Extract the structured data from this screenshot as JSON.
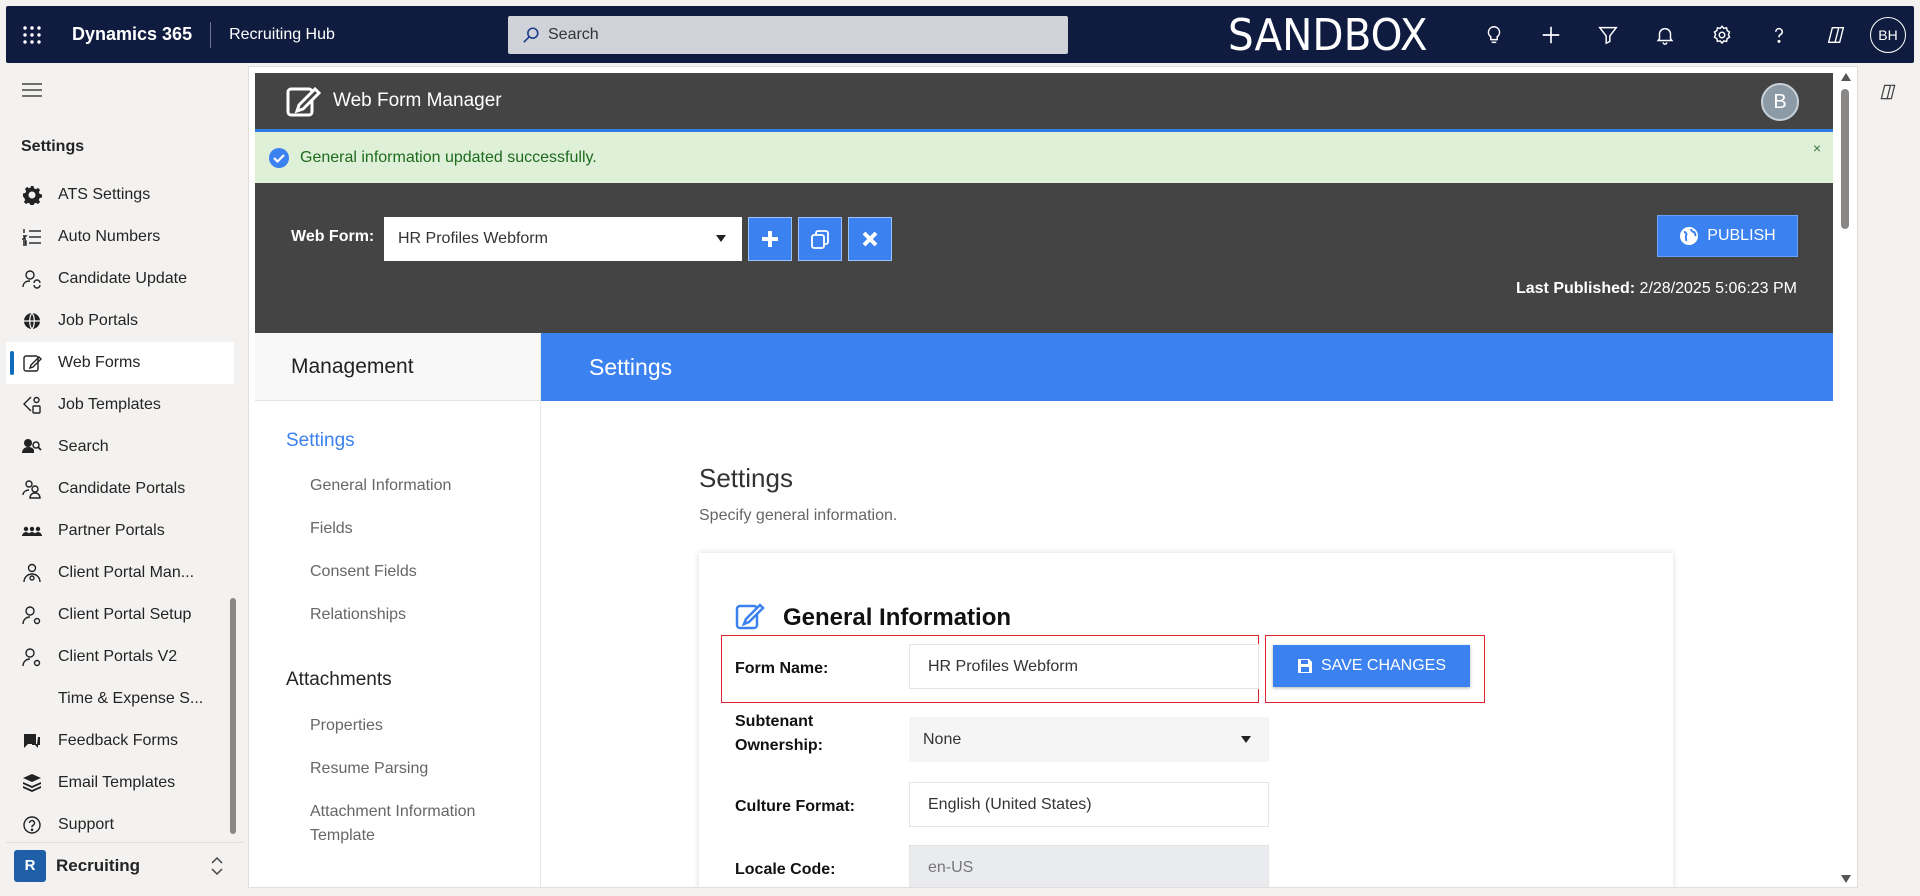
{
  "topbar": {
    "app_name": "Dynamics 365",
    "area_name": "Recruiting Hub",
    "search_placeholder": "Search",
    "environment": "SANDBOX",
    "user_initials": "BH"
  },
  "sidebar": {
    "heading": "Settings",
    "items": [
      {
        "label": "ATS Settings",
        "icon": "gear-icon"
      },
      {
        "label": "Auto Numbers",
        "icon": "numbered-list-icon"
      },
      {
        "label": "Candidate Update",
        "icon": "person-sync-icon"
      },
      {
        "label": "Job Portals",
        "icon": "globe-icon"
      },
      {
        "label": "Web Forms",
        "icon": "form-edit-icon",
        "active": true
      },
      {
        "label": "Job Templates",
        "icon": "template-icon"
      },
      {
        "label": "Search",
        "icon": "search-people-icon"
      },
      {
        "label": "Candidate Portals",
        "icon": "people-icon"
      },
      {
        "label": "Partner Portals",
        "icon": "group-icon"
      },
      {
        "label": "Client Portal Man...",
        "icon": "person-settings-icon"
      },
      {
        "label": "Client Portal Setup",
        "icon": "person-icon"
      },
      {
        "label": "Client Portals V2",
        "icon": "person-icon"
      },
      {
        "label": "Time & Expense S...",
        "icon": ""
      },
      {
        "label": "Feedback Forms",
        "icon": "feedback-icon"
      },
      {
        "label": "Email Templates",
        "icon": "layers-icon"
      },
      {
        "label": "Support",
        "icon": "question-icon"
      }
    ],
    "footer": {
      "badge": "R",
      "label": "Recruiting"
    }
  },
  "wfm": {
    "title": "Web Form Manager",
    "avatar": "B",
    "success_message": "General information updated successfully.",
    "close": "×",
    "webform_label": "Web Form:",
    "webform_value": "HR Profiles Webform",
    "publish_label": "PUBLISH",
    "last_published_label": "Last Published:",
    "last_published_value": "2/28/2025 5:06:23 PM"
  },
  "management": {
    "title": "Management",
    "sections": [
      {
        "label": "Settings",
        "items": [
          "General Information",
          "Fields",
          "Consent Fields",
          "Relationships"
        ]
      },
      {
        "label": "Attachments",
        "items": [
          "Properties",
          "Resume Parsing",
          "Attachment Information Template"
        ]
      }
    ]
  },
  "settings": {
    "banner": "Settings",
    "title": "Settings",
    "subtitle": "Specify general information.",
    "card_title": "General Information",
    "form_name_label": "Form Name:",
    "form_name_value": "HR Profiles Webform",
    "save_label": "SAVE CHANGES",
    "subtenant_label": "Subtenant Ownership:",
    "subtenant_value": "None",
    "culture_label": "Culture Format:",
    "culture_value": "English (United States)",
    "locale_label": "Locale Code:",
    "locale_value": "en-US"
  }
}
